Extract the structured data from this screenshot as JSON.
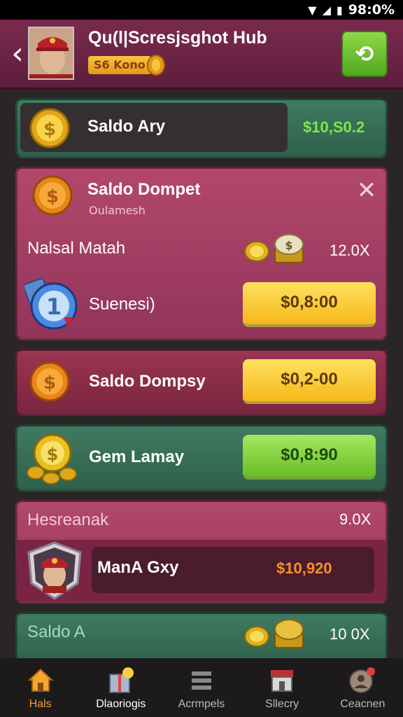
{
  "status": {
    "battery": "98:0%"
  },
  "header": {
    "title": "Qu(l|Scresjsghot Hub",
    "badge": "S6 Kono"
  },
  "cards": {
    "saldo_ary": {
      "label": "Saldo Ary",
      "value": "$10,S0.2"
    },
    "wallet": {
      "label": "Saldo Dompet",
      "sublabel": "Oulamesh",
      "row1_label": "Nalsal Matah",
      "row1_value": "12.0X",
      "row2_label": "Suenesi)",
      "row2_button": "$0,8:00"
    },
    "dompsy": {
      "label": "Saldo Dompsy",
      "button": "$0,2-00"
    },
    "gem": {
      "label": "Gem Lamay",
      "button": "$0,8:90"
    },
    "hesreanak": {
      "label": "Hesreanak",
      "value": "9.0X",
      "player_name": "ManA Gxy",
      "player_value": "$10,920"
    },
    "saldo_a": {
      "label": "Saldo A",
      "value": "10 0X"
    }
  },
  "nav": {
    "items": [
      {
        "label": "Hals",
        "icon": "home-icon"
      },
      {
        "label": "Dlaoriogis",
        "icon": "gift-box-icon"
      },
      {
        "label": "Acrmpels",
        "icon": "stack-icon"
      },
      {
        "label": "Sllecry",
        "icon": "shop-icon"
      },
      {
        "label": "Ceacnen",
        "icon": "profile-icon"
      }
    ]
  },
  "colors": {
    "header": "#6e2446",
    "card_green": "#3f7a62",
    "card_pink": "#b2486c",
    "button_yellow": "#f5b81a",
    "button_green": "#68be26",
    "value_green": "#7ee84a",
    "value_orange": "#f5902a",
    "nav_active": "#f0a040"
  }
}
